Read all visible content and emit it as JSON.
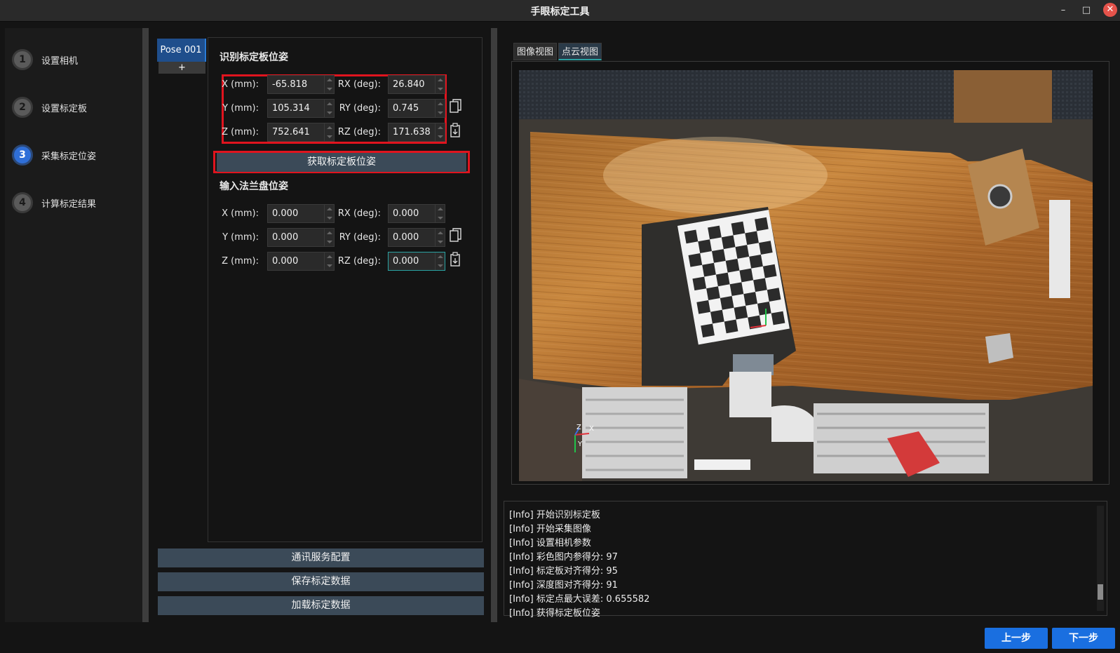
{
  "window": {
    "title": "手眼标定工具",
    "minimize": "–",
    "maximize": "□",
    "close": "✕"
  },
  "steps": [
    {
      "num": "1",
      "label": "设置相机"
    },
    {
      "num": "2",
      "label": "设置标定板"
    },
    {
      "num": "3",
      "label": "采集标定位姿",
      "active": true
    },
    {
      "num": "4",
      "label": "计算标定结果"
    }
  ],
  "pose_tabs": {
    "current": "Pose 001",
    "add": "+"
  },
  "board_pose": {
    "title": "识别标定板位姿",
    "x_label": "X (mm):",
    "x": "-65.818",
    "y_label": "Y (mm):",
    "y": "105.314",
    "z_label": "Z (mm):",
    "z": "752.641",
    "rx_label": "RX (deg):",
    "rx": "26.840",
    "ry_label": "RY (deg):",
    "ry": "0.745",
    "rz_label": "RZ (deg):",
    "rz": "171.638",
    "get_button": "获取标定板位姿"
  },
  "flange_pose": {
    "title": "输入法兰盘位姿",
    "x_label": "X (mm):",
    "x": "0.000",
    "y_label": "Y (mm):",
    "y": "0.000",
    "z_label": "Z (mm):",
    "z": "0.000",
    "rx_label": "RX (deg):",
    "rx": "0.000",
    "ry_label": "RY (deg):",
    "ry": "0.000",
    "rz_label": "RZ (deg):",
    "rz": "0.000"
  },
  "bottom_buttons": {
    "comm": "通讯服务配置",
    "save": "保存标定数据",
    "load": "加载标定数据"
  },
  "view_tabs": [
    "图像视图",
    "点云视图"
  ],
  "active_view_tab": "点云视图",
  "axes": {
    "z": "Z",
    "y": "Y",
    "x": "X"
  },
  "log": [
    "[Info] 开始识别标定板",
    "[Info] 开始采集图像",
    "[Info] 设置相机参数",
    "[Info] 彩色图内参得分:  97",
    "[Info] 标定板对齐得分:  95",
    "[Info] 深度图对齐得分:  91",
    "[Info] 标定点最大误差:  0.655582",
    "[Info] 获得标定板位姿"
  ],
  "nav": {
    "prev": "上一步",
    "next": "下一步"
  },
  "colors": {
    "accent": "#1a6fe0",
    "highlight": "#e0141e",
    "focus": "#2aa3a3"
  }
}
